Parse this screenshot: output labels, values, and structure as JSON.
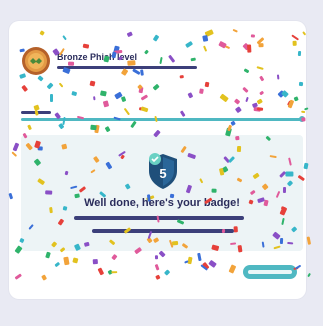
{
  "level": {
    "title": "Bronze Phish level"
  },
  "badge": {
    "number": "5",
    "message": "Well done, here's your badge!"
  },
  "colors": {
    "accent": "#4fb8c2",
    "navy": "#3c3f7a",
    "badge_blue": "#1f4f7a",
    "check_green": "#6ad1c4",
    "bronze": "#c7742f"
  },
  "icons": {
    "medal": "bronze-medal-icon",
    "shield": "shield-badge-icon",
    "check": "check-icon"
  }
}
